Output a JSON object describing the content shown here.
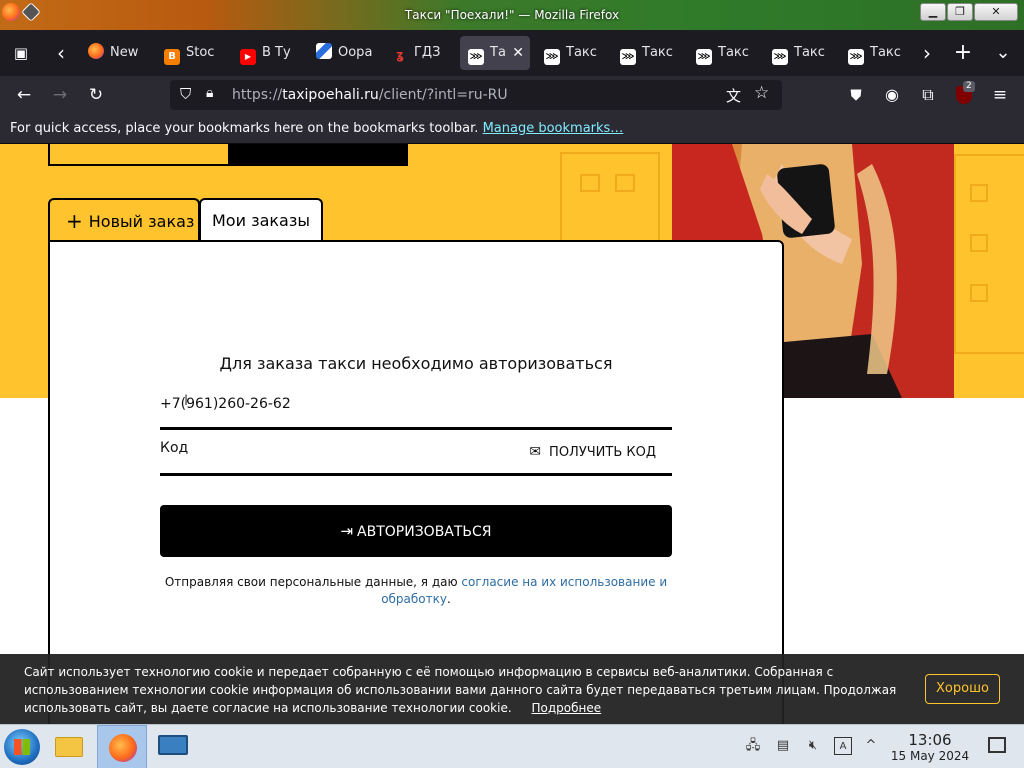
{
  "window": {
    "title": "Такси \"Поехали!\" — Mozilla Firefox",
    "minimize_glyph": "▁",
    "restore_glyph": "❐",
    "close_glyph": "✕"
  },
  "tabs": [
    {
      "label": "New",
      "icon": "firefox-icon",
      "color": "#ff6a1a"
    },
    {
      "label": "Stoc",
      "icon": "blogger-icon",
      "color": "#f57d00"
    },
    {
      "label": "В Ту",
      "icon": "youtube-icon",
      "color": "#ff0000"
    },
    {
      "label": "Оора",
      "icon": "wave-icon",
      "color": "#2a6edb"
    },
    {
      "label": "ГДЗ",
      "icon": "gdz-icon",
      "color": "#e2392d"
    },
    {
      "label": "Та",
      "icon": "taxi-icon",
      "color": "#ffffff",
      "active": true
    },
    {
      "label": "Такс",
      "icon": "taxi-icon",
      "color": "#ffffff"
    },
    {
      "label": "Такс",
      "icon": "taxi-icon",
      "color": "#ffffff"
    },
    {
      "label": "Такс",
      "icon": "taxi-icon",
      "color": "#ffffff"
    },
    {
      "label": "Такс",
      "icon": "taxi-icon",
      "color": "#ffffff"
    },
    {
      "label": "Такс",
      "icon": "taxi-icon",
      "color": "#ffffff"
    }
  ],
  "tab_icons": {
    "new_tab": "+",
    "list_all": "⌄",
    "scroll_left": "‹",
    "scroll_right": "›",
    "close": "✕"
  },
  "nav": {
    "url_prefix": "https://",
    "url_host": "taxipoehali.ru",
    "url_path": "/client/?intl=ru-RU",
    "extension_badge": "2"
  },
  "bookmarks": {
    "message": "For quick access, place your bookmarks here on the bookmarks toolbar.",
    "link": "Manage bookmarks…"
  },
  "page": {
    "order_tabs": {
      "new_order_icon": "+",
      "new_order": "Новый заказ",
      "my_orders": "Мои заказы"
    },
    "auth": {
      "title": "Для заказа такси необходимо авторизоваться",
      "phone_value": "+7(961)260-26-62",
      "code_placeholder": "Код",
      "get_code": "ПОЛУЧИТЬ КОД",
      "submit": "АВТОРИЗОВАТЬСЯ",
      "consent_text": "Отправляя свои персональные данные, я даю ",
      "consent_link": "согласие на их использование и обработку",
      "consent_end": "."
    },
    "cookie": {
      "text": "Сайт использует технологию cookie и передает собранную с её помощью информацию в сервисы веб-аналитики. Собранная с использованием технологии cookie информация об использовании вами данного сайта будет передаваться третьим лицам. Продолжая использовать сайт, вы даете согласие на использование технологии cookie.",
      "more": "Подробнее",
      "ok": "Хорошо"
    }
  },
  "taskbar": {
    "time": "13:06",
    "date": "15 May 2024"
  },
  "colors": {
    "brand_yellow": "#fec32d",
    "firefox_dark": "#1c1b22",
    "toolbar": "#2b2a33",
    "link_blue": "#2e6da4"
  }
}
